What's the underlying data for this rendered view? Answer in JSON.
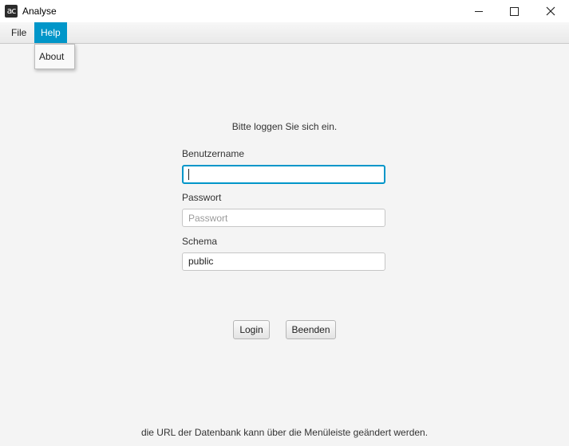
{
  "window": {
    "title": "Analyse",
    "icon_text": "ac"
  },
  "menubar": {
    "items": [
      {
        "label": "File"
      },
      {
        "label": "Help"
      }
    ],
    "open_menu": {
      "items": [
        {
          "label": "About"
        }
      ]
    }
  },
  "login": {
    "prompt": "Bitte loggen Sie sich ein.",
    "username": {
      "label": "Benutzername",
      "value": ""
    },
    "password": {
      "label": "Passwort",
      "placeholder": "Passwort",
      "value": ""
    },
    "schema": {
      "label": "Schema",
      "value": "public"
    },
    "login_button": "Login",
    "quit_button": "Beenden"
  },
  "footer": {
    "hint": "die URL der Datenbank kann über die Menüleiste geändert werden."
  },
  "colors": {
    "accent": "#0096c9",
    "background": "#f4f4f4"
  }
}
